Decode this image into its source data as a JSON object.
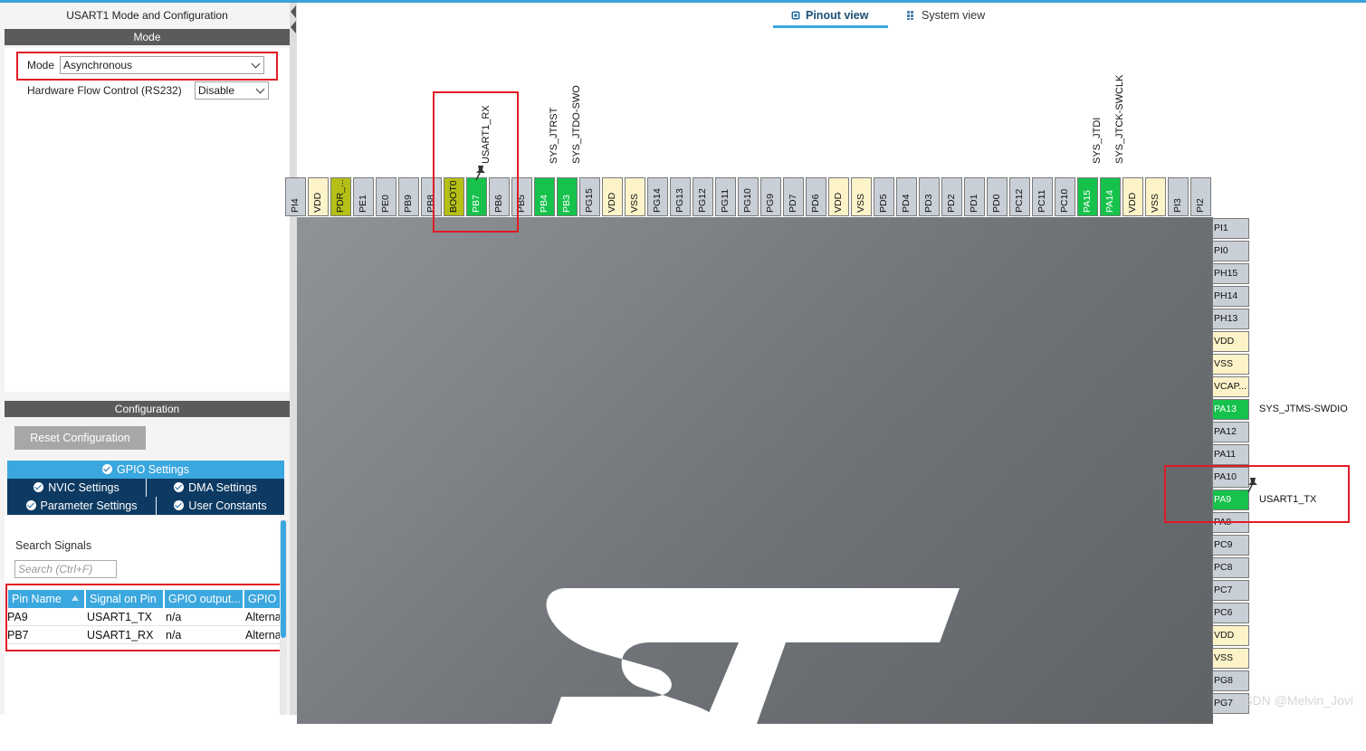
{
  "mode_panel": {
    "title": "USART1 Mode and Configuration",
    "section_label": "Mode",
    "mode_label": "Mode",
    "mode_value": "Asynchronous",
    "hfc_label": "Hardware Flow Control (RS232)",
    "hfc_value": "Disable"
  },
  "config_panel": {
    "section_label": "Configuration",
    "reset_button": "Reset Configuration",
    "tabs": {
      "gpio": "GPIO Settings",
      "nvic": "NVIC Settings",
      "dma": "DMA Settings",
      "parameter": "Parameter Settings",
      "user_constants": "User Constants"
    },
    "search_label": "Search Signals",
    "search_placeholder": "Search (Ctrl+F)",
    "table": {
      "headers": [
        "Pin Name",
        "Signal on Pin",
        "GPIO output...",
        "GPIO"
      ],
      "rows": [
        [
          "PA9",
          "USART1_TX",
          "n/a",
          "Alterna"
        ],
        [
          "PB7",
          "USART1_RX",
          "n/a",
          "Alterna"
        ]
      ]
    }
  },
  "views": {
    "pinout": "Pinout view",
    "system": "System view"
  },
  "top_pins": [
    {
      "name": "PI4",
      "kind": "gray"
    },
    {
      "name": "VDD",
      "kind": "yellow"
    },
    {
      "name": "PDR_...",
      "kind": "olive"
    },
    {
      "name": "PE1",
      "kind": "gray"
    },
    {
      "name": "PE0",
      "kind": "gray"
    },
    {
      "name": "PB9",
      "kind": "gray"
    },
    {
      "name": "PB8",
      "kind": "gray"
    },
    {
      "name": "BOOT0",
      "kind": "olive"
    },
    {
      "name": "PB7",
      "kind": "green"
    },
    {
      "name": "PB6",
      "kind": "gray"
    },
    {
      "name": "PB5",
      "kind": "gray"
    },
    {
      "name": "PB4",
      "kind": "green"
    },
    {
      "name": "PB3",
      "kind": "green"
    },
    {
      "name": "PG15",
      "kind": "gray"
    },
    {
      "name": "VDD",
      "kind": "yellow"
    },
    {
      "name": "VSS",
      "kind": "yellow"
    },
    {
      "name": "PG14",
      "kind": "gray"
    },
    {
      "name": "PG13",
      "kind": "gray"
    },
    {
      "name": "PG12",
      "kind": "gray"
    },
    {
      "name": "PG11",
      "kind": "gray"
    },
    {
      "name": "PG10",
      "kind": "gray"
    },
    {
      "name": "PG9",
      "kind": "gray"
    },
    {
      "name": "PD7",
      "kind": "gray"
    },
    {
      "name": "PD6",
      "kind": "gray"
    },
    {
      "name": "VDD",
      "kind": "yellow"
    },
    {
      "name": "VSS",
      "kind": "yellow"
    },
    {
      "name": "PD5",
      "kind": "gray"
    },
    {
      "name": "PD4",
      "kind": "gray"
    },
    {
      "name": "PD3",
      "kind": "gray"
    },
    {
      "name": "PD2",
      "kind": "gray"
    },
    {
      "name": "PD1",
      "kind": "gray"
    },
    {
      "name": "PD0",
      "kind": "gray"
    },
    {
      "name": "PC12",
      "kind": "gray"
    },
    {
      "name": "PC11",
      "kind": "gray"
    },
    {
      "name": "PC10",
      "kind": "gray"
    },
    {
      "name": "PA15",
      "kind": "green"
    },
    {
      "name": "PA14",
      "kind": "green"
    },
    {
      "name": "VDD",
      "kind": "yellow"
    },
    {
      "name": "VSS",
      "kind": "yellow"
    },
    {
      "name": "PI3",
      "kind": "gray"
    },
    {
      "name": "PI2",
      "kind": "gray"
    }
  ],
  "top_signals": [
    {
      "pin": "PB7",
      "label": "USART1_RX"
    },
    {
      "pin": "PB4",
      "label": "SYS_JTRST"
    },
    {
      "pin": "PB3",
      "label": "SYS_JTDO-SWO"
    },
    {
      "pin": "PA15",
      "label": "SYS_JTDI"
    },
    {
      "pin": "PA14",
      "label": "SYS_JTCK-SWCLK"
    }
  ],
  "right_pins": [
    {
      "name": "PI1",
      "kind": "gray"
    },
    {
      "name": "PI0",
      "kind": "gray"
    },
    {
      "name": "PH15",
      "kind": "gray"
    },
    {
      "name": "PH14",
      "kind": "gray"
    },
    {
      "name": "PH13",
      "kind": "gray"
    },
    {
      "name": "VDD",
      "kind": "yellow"
    },
    {
      "name": "VSS",
      "kind": "yellow"
    },
    {
      "name": "VCAP...",
      "kind": "yellow"
    },
    {
      "name": "PA13",
      "kind": "green"
    },
    {
      "name": "PA12",
      "kind": "gray"
    },
    {
      "name": "PA11",
      "kind": "gray"
    },
    {
      "name": "PA10",
      "kind": "gray"
    },
    {
      "name": "PA9",
      "kind": "green"
    },
    {
      "name": "PA8",
      "kind": "gray"
    },
    {
      "name": "PC9",
      "kind": "gray"
    },
    {
      "name": "PC8",
      "kind": "gray"
    },
    {
      "name": "PC7",
      "kind": "gray"
    },
    {
      "name": "PC6",
      "kind": "gray"
    },
    {
      "name": "VDD",
      "kind": "yellow"
    },
    {
      "name": "VSS",
      "kind": "yellow"
    },
    {
      "name": "PG8",
      "kind": "gray"
    },
    {
      "name": "PG7",
      "kind": "gray"
    }
  ],
  "right_signals": [
    {
      "pin": "PA13",
      "label": "SYS_JTMS-SWDIO"
    },
    {
      "pin": "PA9",
      "label": "USART1_TX"
    }
  ],
  "watermark": "CSDN @Melvin_Jovi"
}
